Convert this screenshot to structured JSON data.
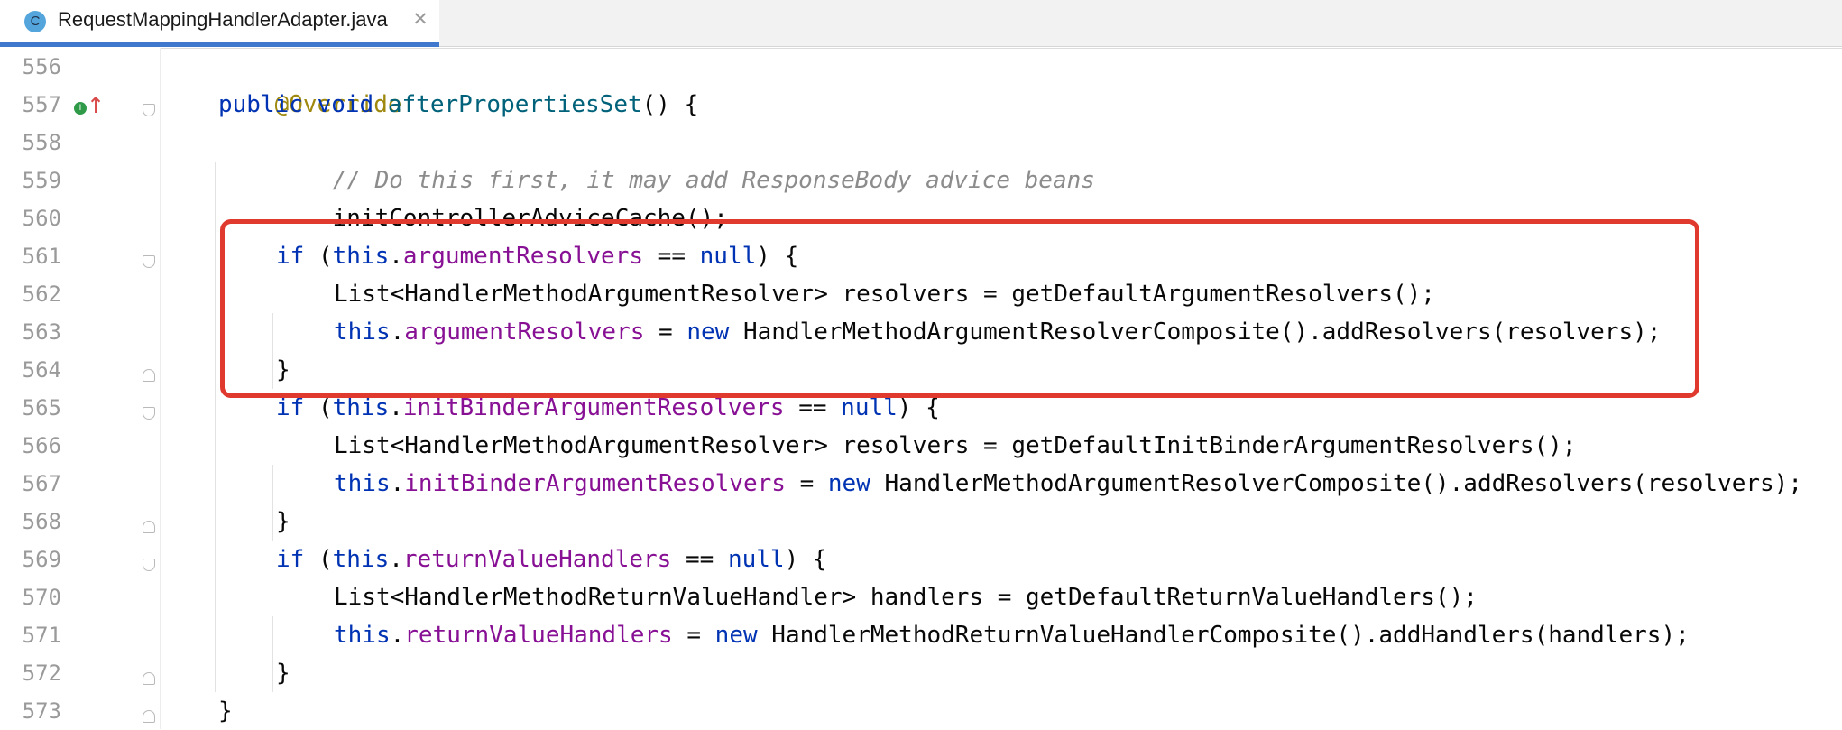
{
  "tab": {
    "icon_letter": "C",
    "filename": "RequestMappingHandlerAdapter.java",
    "close_glyph": "✕"
  },
  "gutter": {
    "line_numbers": [
      "556",
      "557",
      "558",
      "559",
      "560",
      "561",
      "562",
      "563",
      "564",
      "565",
      "566",
      "567",
      "568",
      "569",
      "570",
      "571",
      "572",
      "573"
    ],
    "override_badge": "I",
    "override_arrow": "↑"
  },
  "code": {
    "l556": "@Override",
    "l557_kw1": "public",
    "l557_kw2": "void",
    "l557_fn": "afterPropertiesSet",
    "l557_rest": "() {",
    "l558": "// Do this first, it may add ResponseBody advice beans",
    "l559": "initControllerAdviceCache();",
    "l561_if": "if",
    "l561_open": " (",
    "l561_this": "this",
    "l561_dot": ".",
    "l561_field": "argumentResolvers",
    "l561_eq": " == ",
    "l561_null": "null",
    "l561_close": ") {",
    "l562": "List<HandlerMethodArgumentResolver> resolvers = getDefaultArgumentResolvers();",
    "l563_this": "this",
    "l563_dot": ".",
    "l563_field": "argumentResolvers",
    "l563_eq": " = ",
    "l563_new": "new",
    "l563_rest": " HandlerMethodArgumentResolverComposite().addResolvers(resolvers);",
    "l564": "}",
    "l565_if": "if",
    "l565_open": " (",
    "l565_this": "this",
    "l565_dot": ".",
    "l565_field": "initBinderArgumentResolvers",
    "l565_eq": " == ",
    "l565_null": "null",
    "l565_close": ") {",
    "l566": "List<HandlerMethodArgumentResolver> resolvers = getDefaultInitBinderArgumentResolvers();",
    "l567_this": "this",
    "l567_dot": ".",
    "l567_field": "initBinderArgumentResolvers",
    "l567_eq": " = ",
    "l567_new": "new",
    "l567_rest": " HandlerMethodArgumentResolverComposite().addResolvers(resolvers);",
    "l568": "}",
    "l569_if": "if",
    "l569_open": " (",
    "l569_this": "this",
    "l569_dot": ".",
    "l569_field": "returnValueHandlers",
    "l569_eq": " == ",
    "l569_null": "null",
    "l569_close": ") {",
    "l570": "List<HandlerMethodReturnValueHandler> handlers = getDefaultReturnValueHandlers();",
    "l571_this": "this",
    "l571_dot": ".",
    "l571_field": "returnValueHandlers",
    "l571_eq": " = ",
    "l571_new": "new",
    "l571_rest": " HandlerMethodReturnValueHandlerComposite().addHandlers(handlers);",
    "l572": "}",
    "l573": "}"
  },
  "colors": {
    "keyword": "#0033b3",
    "field": "#871094",
    "comment": "#8c8c8c",
    "annotation": "#9e880d",
    "highlight_border": "#e03a2f",
    "tab_underline": "#3f78cc"
  }
}
